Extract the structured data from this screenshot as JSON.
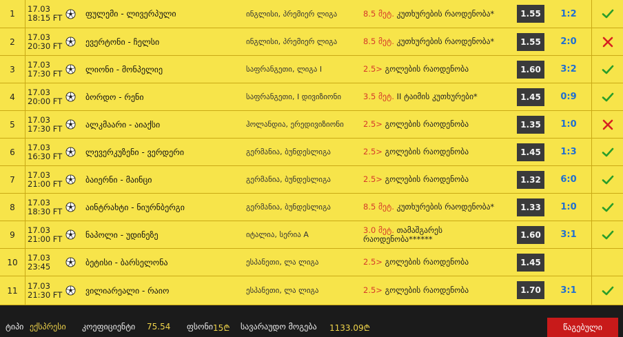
{
  "rows": [
    {
      "num": "1",
      "date": "17.03",
      "time": "18:15 FT",
      "match": "ფულემი - ლივერპული",
      "league": "ინგლისი, პრემიერ ლიგა",
      "bet_hl": "8.5 მეტ.",
      "bet_rest": " კუთხურების რაოდენობა*",
      "odds": "1.55",
      "score": "1:2",
      "status": "win"
    },
    {
      "num": "2",
      "date": "17.03",
      "time": "20:30 FT",
      "match": "ევერტონი - ჩელსი",
      "league": "ინგლისი, პრემიერ ლიგა",
      "bet_hl": "8.5 მეტ.",
      "bet_rest": " კუთხურების რაოდენობა*",
      "odds": "1.55",
      "score": "2:0",
      "status": "lose"
    },
    {
      "num": "3",
      "date": "17.03",
      "time": "17:30 FT",
      "match": "ლიონი - მონპელიე",
      "league": "საფრანგეთი, ლიგა I",
      "bet_hl": "2.5>",
      "bet_rest": " გოლების რაოდენობა",
      "odds": "1.60",
      "score": "3:2",
      "status": "win"
    },
    {
      "num": "4",
      "date": "17.03",
      "time": "20:00 FT",
      "match": "ბორდო - რენი",
      "league": "საფრანგეთი, I დივიზიონი",
      "bet_hl": "3.5 მეტ.",
      "bet_rest": " II ტაიმის კუთხურები*",
      "odds": "1.45",
      "score": "0:9",
      "status": "win"
    },
    {
      "num": "5",
      "date": "17.03",
      "time": "17:30 FT",
      "match": "ალკმაარი - აიაქსი",
      "league": "ჰოლანდია, ერედივიზიონი",
      "bet_hl": "2.5>",
      "bet_rest": " გოლების რაოდენობა",
      "odds": "1.35",
      "score": "1:0",
      "status": "lose"
    },
    {
      "num": "6",
      "date": "17.03",
      "time": "16:30 FT",
      "match": "ლევერკუზენი - ვერდერი",
      "league": "გერმანია, ბუნდესლიგა",
      "bet_hl": "2.5>",
      "bet_rest": " გოლების რაოდენობა",
      "odds": "1.45",
      "score": "1:3",
      "status": "win"
    },
    {
      "num": "7",
      "date": "17.03",
      "time": "21:00 FT",
      "match": "ბაიერნი - მაინცი",
      "league": "გერმანია, ბუნდესლიგა",
      "bet_hl": "2.5>",
      "bet_rest": " გოლების რაოდენობა",
      "odds": "1.32",
      "score": "6:0",
      "status": "win"
    },
    {
      "num": "8",
      "date": "17.03",
      "time": "18:30 FT",
      "match": "აინტრახტი - ნიურნბერგი",
      "league": "გერმანია, ბუნდესლიგა",
      "bet_hl": "8.5 მეტ.",
      "bet_rest": " კუთხურების რაოდენობა*",
      "odds": "1.33",
      "score": "1:0",
      "status": "win"
    },
    {
      "num": "9",
      "date": "17.03",
      "time": "21:00 FT",
      "match": "ნაპოლი - უდინეზე",
      "league": "იტალია, სერია A",
      "bet_hl": "3.0 მეტ.",
      "bet_rest": " თამაშგარეს რაოდენობა******",
      "odds": "1.60",
      "score": "3:1",
      "status": "win"
    },
    {
      "num": "10",
      "date": "17.03",
      "time": "23:45",
      "match": "ბეტისი - ბარსელონა",
      "league": "ესპანეთი, ლა ლიგა",
      "bet_hl": "2.5>",
      "bet_rest": " გოლების რაოდენობა",
      "odds": "1.45",
      "score": "",
      "status": "none"
    },
    {
      "num": "11",
      "date": "17.03",
      "time": "21:30 FT",
      "match": "ვილიარეალი - რაიო",
      "league": "ესპანეთი, ლა ლიგა",
      "bet_hl": "2.5>",
      "bet_rest": " გოლების რაოდენობა",
      "odds": "1.70",
      "score": "3:1",
      "status": "win"
    }
  ],
  "footer": {
    "type_label": "ტიპი",
    "type_value": "ექსპრესი",
    "coef_label": "კოეფიციენტი",
    "coef_value": "75.54",
    "stake_label": "ფსონი",
    "stake_value": "15₾",
    "win_label": "სავარაუდო მოგება",
    "win_value": "1133.09₾",
    "submit_label": "წაგებული"
  },
  "colors": {
    "row_bg": "#f7e44a",
    "win": "#2a9d2a",
    "lose": "#d62020",
    "score": "#1f6fd1",
    "odds_bg": "#3a3a3a",
    "highlight": "#d63a2a"
  }
}
